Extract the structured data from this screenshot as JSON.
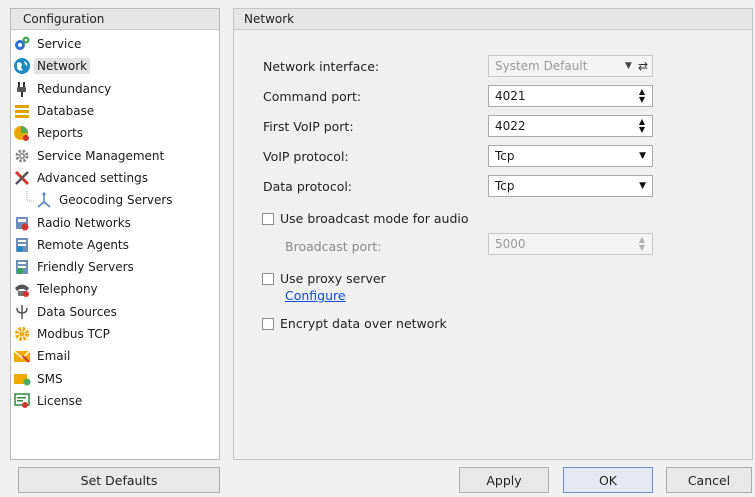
{
  "left": {
    "header": "Configuration",
    "items": [
      {
        "label": "Service",
        "icon": "service-icon"
      },
      {
        "label": "Network",
        "icon": "network-globe-icon",
        "selected": true
      },
      {
        "label": "Redundancy",
        "icon": "redundancy-plug-icon"
      },
      {
        "label": "Database",
        "icon": "database-icon"
      },
      {
        "label": "Reports",
        "icon": "reports-icon"
      },
      {
        "label": "Service Management",
        "icon": "gear-icon"
      },
      {
        "label": "Advanced settings",
        "icon": "tools-icon"
      },
      {
        "label": "Geocoding Servers",
        "icon": "geocoding-icon",
        "child": true
      },
      {
        "label": "Radio Networks",
        "icon": "radio-networks-icon"
      },
      {
        "label": "Remote Agents",
        "icon": "remote-agents-icon"
      },
      {
        "label": "Friendly Servers",
        "icon": "friendly-servers-icon"
      },
      {
        "label": "Telephony",
        "icon": "telephony-icon"
      },
      {
        "label": "Data Sources",
        "icon": "data-sources-icon"
      },
      {
        "label": "Modbus TCP",
        "icon": "modbus-icon"
      },
      {
        "label": "Email",
        "icon": "email-icon"
      },
      {
        "label": "SMS",
        "icon": "sms-icon"
      },
      {
        "label": "License",
        "icon": "license-icon"
      }
    ]
  },
  "right": {
    "header": "Network",
    "network_interface": {
      "label": "Network interface:",
      "value": "System Default"
    },
    "command_port": {
      "label": "Command port:",
      "value": "4021"
    },
    "first_voip_port": {
      "label": "First VoIP port:",
      "value": "4022"
    },
    "voip_protocol": {
      "label": "VoIP protocol:",
      "value": "Tcp"
    },
    "data_protocol": {
      "label": "Data protocol:",
      "value": "Tcp"
    },
    "broadcast_mode": {
      "label": "Use broadcast mode for audio"
    },
    "broadcast_port": {
      "label": "Broadcast port:",
      "value": "5000"
    },
    "proxy": {
      "label": "Use proxy server",
      "link": "Configure"
    },
    "encrypt": {
      "label": "Encrypt data over network"
    }
  },
  "buttons": {
    "set_defaults": "Set Defaults",
    "apply": "Apply",
    "ok": "OK",
    "cancel": "Cancel"
  }
}
